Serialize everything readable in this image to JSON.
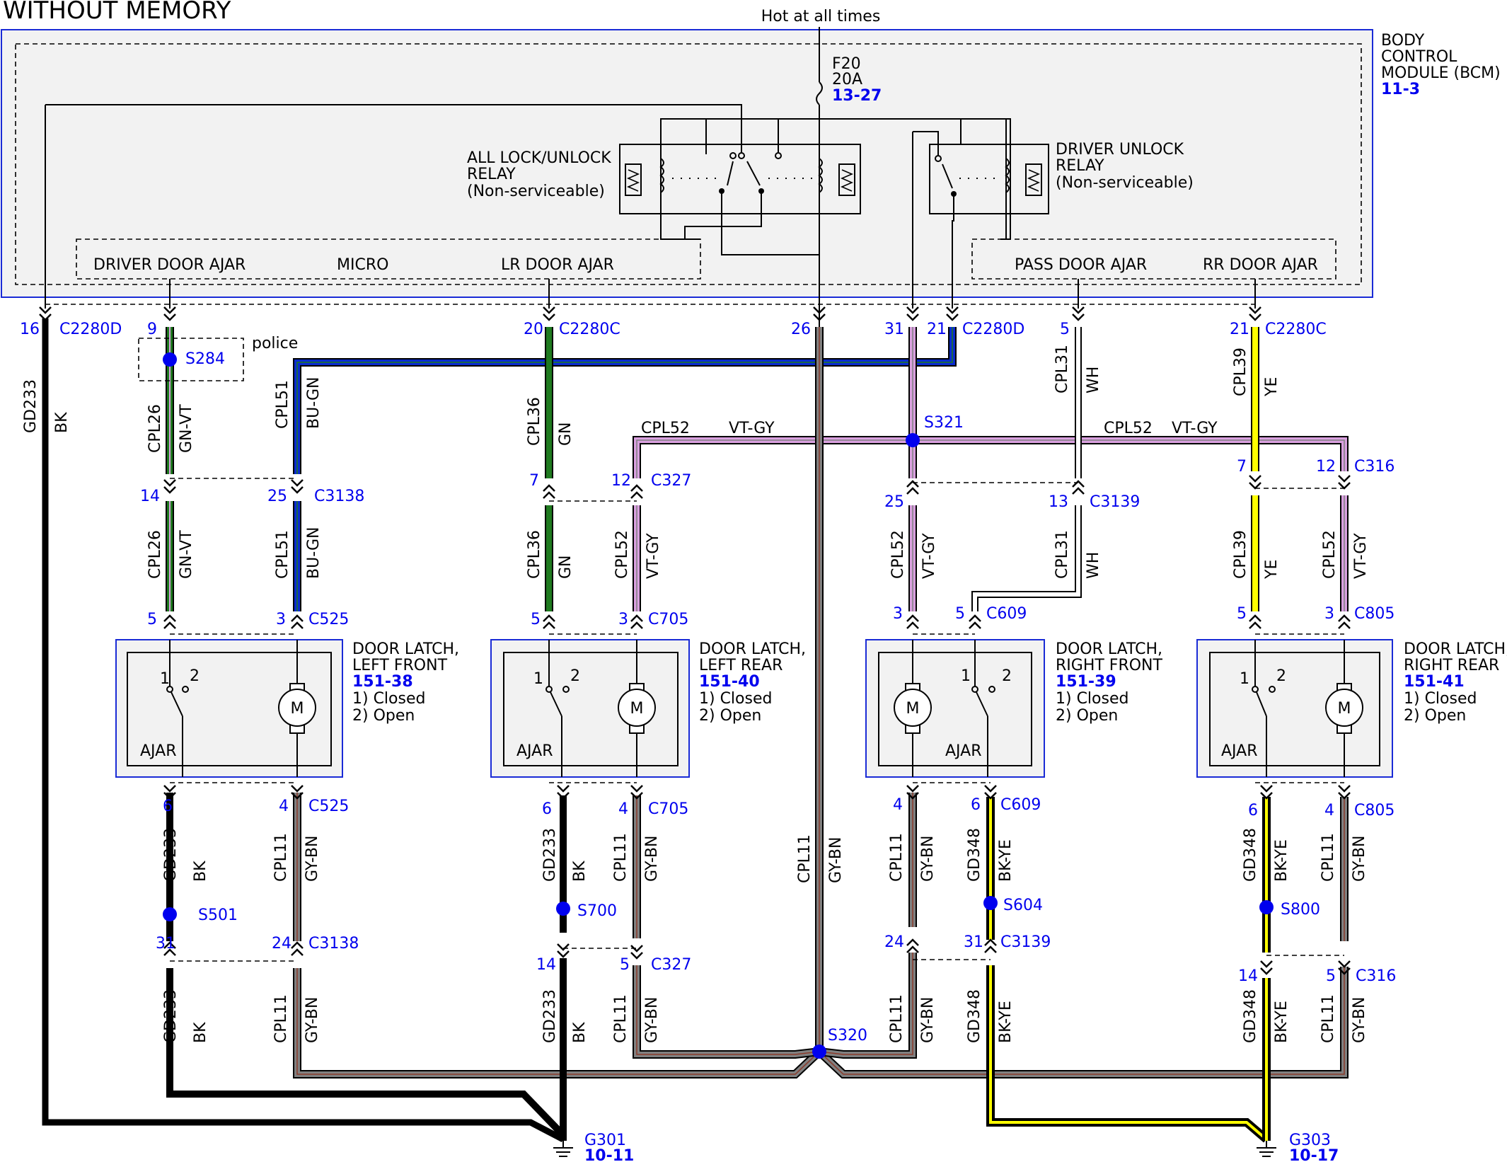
{
  "title": "WITHOUT MEMORY",
  "power": {
    "label": "Hot at all times",
    "fuse": "F20",
    "rating": "20A",
    "ref": "13-27"
  },
  "bcm": {
    "lines": [
      "BODY",
      "CONTROL",
      "MODULE (BCM)"
    ],
    "ref": "11-3"
  },
  "relays": {
    "all_lock": [
      "ALL LOCK/UNLOCK",
      "RELAY",
      "(Non-serviceable)"
    ],
    "driver_unlock": [
      "DRIVER UNLOCK",
      "RELAY",
      "(Non-serviceable)"
    ]
  },
  "micro": {
    "driver_door_ajar": "DRIVER DOOR AJAR",
    "micro": "MICRO",
    "lr_door_ajar": "LR DOOR AJAR",
    "pass_door_ajar": "PASS DOOR AJAR",
    "rr_door_ajar": "RR DOOR AJAR"
  },
  "colors": {
    "GN": "#1f7a1f",
    "BU": "#0a2bd0",
    "VT": "#d9a0df",
    "GY": "#808080",
    "BN": "#8b3a2a",
    "BK": "#000000",
    "WH": "#ffffff",
    "YE": "#ffff00",
    "link": "#0000ee",
    "box": "#1a2bd6"
  },
  "pins": {
    "p16": "16",
    "c2280d_a": "C2280D",
    "p9": "9",
    "police": "police",
    "s284": "S284",
    "p20": "20",
    "c2280c_a": "C2280C",
    "p26": "26",
    "p31": "31",
    "p21a": "21",
    "c2280d_b": "C2280D",
    "p5": "5",
    "p21b": "21",
    "c2280c_b": "C2280C",
    "c3138_n": "14",
    "c3138_n2": "25",
    "c3138": "C3138",
    "c327_n7": "7",
    "c327_n12": "12",
    "c327": "C327",
    "c3139_n25": "25",
    "c3139_n13": "13",
    "c3139": "C3139",
    "c316_n7": "7",
    "c316_n12": "12",
    "c316": "C316",
    "c525_n5": "5",
    "c525_n3": "3",
    "c525": "C525",
    "c705_n5": "5",
    "c705_n3": "3",
    "c705": "C705",
    "c609_n3": "3",
    "c609_n5": "5",
    "c609": "C609",
    "c805_n5": "5",
    "c805_n3": "3",
    "c805": "C805",
    "s321": "S321",
    "cpl52": "CPL52",
    "vtgy": "VT-GY",
    "cpl52b": "CPL52",
    "vtgyb": "VT-GY",
    "l_c525_6": "6",
    "l_c525_4": "4",
    "l_c525": "C525",
    "l_c705_6": "6",
    "l_c705_4": "4",
    "l_c705": "C705",
    "l_c609_4": "4",
    "l_c609_6": "6",
    "l_c609": "C609",
    "l_c805_6": "6",
    "l_c805_4": "4",
    "l_c805": "C805",
    "s501": "S501",
    "s700": "S700",
    "s604": "S604",
    "s800": "S800",
    "s320": "S320",
    "c3138b_31": "31",
    "c3138b_24": "24",
    "c3138b": "C3138",
    "c327b_14": "14",
    "c327b_5": "5",
    "c327b": "C327",
    "c3139b_24": "24",
    "c3139b_31": "31",
    "c3139b": "C3139",
    "c316b_14": "14",
    "c316b_5": "5",
    "c316b": "C316",
    "g301": "G301",
    "g301_ref": "10-11",
    "g303": "G303",
    "g303_ref": "10-17"
  },
  "wires": {
    "gd233": "GD233",
    "bk": "BK",
    "cpl26": "CPL26",
    "gnvt": "GN-VT",
    "cpl51": "CPL51",
    "bugn": "BU-GN",
    "cpl36": "CPL36",
    "gn": "GN",
    "cpl52": "CPL52",
    "vtgy": "VT-GY",
    "cpl31": "CPL31",
    "wh": "WH",
    "cpl39": "CPL39",
    "ye": "YE",
    "cpl11": "CPL11",
    "gybn": "GY-BN",
    "gd348": "GD348",
    "bkye": "BK-YE"
  },
  "latches": {
    "lf": {
      "lines": [
        "DOOR LATCH,",
        "LEFT FRONT"
      ],
      "ref": "151-38"
    },
    "lr": {
      "lines": [
        "DOOR LATCH,",
        "LEFT REAR"
      ],
      "ref": "151-40"
    },
    "rf": {
      "lines": [
        "DOOR LATCH,",
        "RIGHT FRONT"
      ],
      "ref": "151-39"
    },
    "rr": {
      "lines": [
        "DOOR LATCH,",
        "RIGHT REAR"
      ],
      "ref": "151-41"
    },
    "closed": "1) Closed",
    "open": "2) Open",
    "ajar": "AJAR",
    "motor": "M",
    "one": "1",
    "two": "2"
  }
}
